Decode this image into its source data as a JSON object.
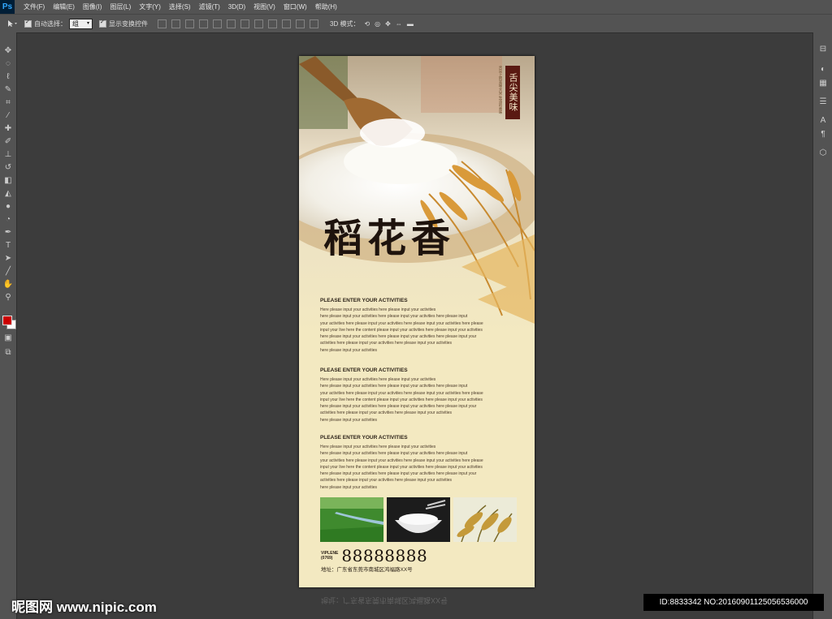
{
  "app": {
    "logo": "Ps"
  },
  "menu": [
    "文件(F)",
    "编辑(E)",
    "图像(I)",
    "图层(L)",
    "文字(Y)",
    "选择(S)",
    "滤镜(T)",
    "3D(D)",
    "视图(V)",
    "窗口(W)",
    "帮助(H)"
  ],
  "options": {
    "auto_select_label": "自动选择：",
    "auto_select_value": "组",
    "transform_label": "显示变换控件",
    "mode_3d_label": "3D 模式："
  },
  "poster": {
    "stamp": "舌尖美味",
    "stamp_side": "舌尖上的美味大米 生活的美味",
    "title": "稻花香",
    "sections": [
      {
        "heading": "PLEASE ENTER YOUR ACTIVITIES",
        "body": [
          "Here please input your activities here please input your activities",
          "here please input your activities here please input your activities here please input",
          "your activities here please input your activities here please input your activities here please",
          "input your live here the content please input your activities here please input your activities",
          "here please input your activities here please input your activities here please input your",
          " activities here please input your activities here please input your activities",
          "here please input your activities"
        ]
      },
      {
        "heading": "PLEASE ENTER YOUR ACTIVITIES",
        "body": [
          "Here please input your activities here please input your activities",
          "here please input your activities here please input your activities here please input",
          "your activities here please input your activities here please input your activities here please",
          "input your live here the content please input your activities here please input your activities",
          "here please input your activities here please input your activities here please input your",
          " activities here please input your activities here please input your activities",
          "here please input your activities"
        ]
      },
      {
        "heading": "PLEASE ENTER YOUR ACTIVITIES",
        "body": [
          "Here please input your activities here please input your activities",
          "here please input your activities here please input your activities here please input",
          "your activities here please input your activities here please input your activities here please",
          "input your live here the content please input your activities here please input your activities",
          "here please input your activities here please input your activities here please input your",
          " activities here please input your activities here please input your activities",
          "here please input your activities"
        ]
      }
    ],
    "vip_label": "VIPLENE",
    "area_code": "(0769)",
    "phone": "88888888",
    "address": "地址：广东省东莞市南城区鸿福路XX号",
    "reflection_text": "地址：广东省东莞市南城区鸿福路XX号"
  },
  "watermark": {
    "left": "昵图网 www.nipic.com",
    "right": "ID:8833342 NO:20160901125056536000"
  },
  "colors": {
    "paper": "#f3e9c1",
    "stamp": "#5a1a12",
    "foreground_swatch": "#cc0000"
  }
}
